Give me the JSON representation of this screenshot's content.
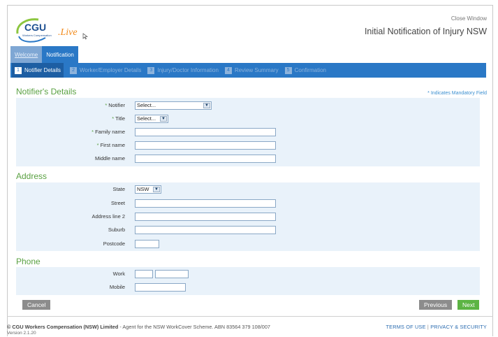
{
  "header": {
    "logo_text": "CGU",
    "logo_sub": "Workers Compensation",
    "live_text": ".Live",
    "close_label": "Close Window",
    "title": "Initial Notification of Injury NSW"
  },
  "top_tabs": [
    {
      "label": "Welcome"
    },
    {
      "label": "Notification"
    }
  ],
  "steps": [
    {
      "num": "1",
      "label": "Notifier Details"
    },
    {
      "num": "2",
      "label": "Worker/Employer Details"
    },
    {
      "num": "3",
      "label": "Injury/Doctor Information"
    },
    {
      "num": "4",
      "label": "Review Summary"
    },
    {
      "num": "5",
      "label": "Confirmation"
    }
  ],
  "notifier": {
    "title": "Notifier's Details",
    "mandatory_note": "* Indicates Mandatory Field",
    "notifier_label": "Notifier",
    "notifier_value": "Select...",
    "title_label": "Title",
    "title_value": "Select...",
    "family_label": "Family name",
    "first_label": "First name",
    "middle_label": "Middle name"
  },
  "address": {
    "title": "Address",
    "state_label": "State",
    "state_value": "NSW",
    "street_label": "Street",
    "line2_label": "Address line 2",
    "suburb_label": "Suburb",
    "postcode_label": "Postcode"
  },
  "phone": {
    "title": "Phone",
    "work_label": "Work",
    "mobile_label": "Mobile"
  },
  "buttons": {
    "cancel": "Cancel",
    "previous": "Previous",
    "next": "Next"
  },
  "footer": {
    "company": "© CGU Workers Compensation (NSW) Limited",
    "agent_text": " - Agent for the NSW WorkCover Scheme. ABN 83564 379 108/007",
    "version": "Version 2.1.20",
    "terms": "TERMS OF USE",
    "separator": "|",
    "privacy": "PRIVACY & SECURITY"
  },
  "colors": {
    "brand_blue": "#2a78c6",
    "brand_green": "#5aa142",
    "panel_bg": "#e9f2fa"
  }
}
